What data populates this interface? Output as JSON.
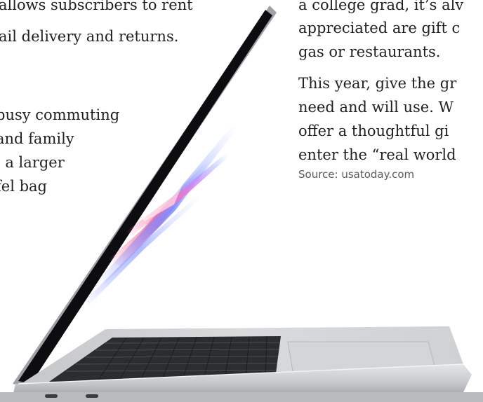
{
  "left_column": {
    "lines_top": [
      "allows subscribers to rent",
      "ail delivery and returns."
    ],
    "lines_bottom": [
      "busy commuting",
      "and family",
      ", a larger",
      "fel bag"
    ]
  },
  "right_column": {
    "lines_top": [
      "a college grad, it’s alv",
      "appreciated are gift c",
      "gas or restaurants."
    ],
    "lines_bottom": [
      "This year, give the gr",
      "need and will use. W",
      "offer a thoughtful gi",
      "enter the “real world"
    ],
    "source": "Source: usatoday.com"
  },
  "colors": {
    "text": "#231f20",
    "source_text": "#58595b",
    "laptop_body": "#c9cbce",
    "screen_bezel": "#0b0b0d"
  },
  "icons": {
    "laptop": "laptop-photo"
  }
}
